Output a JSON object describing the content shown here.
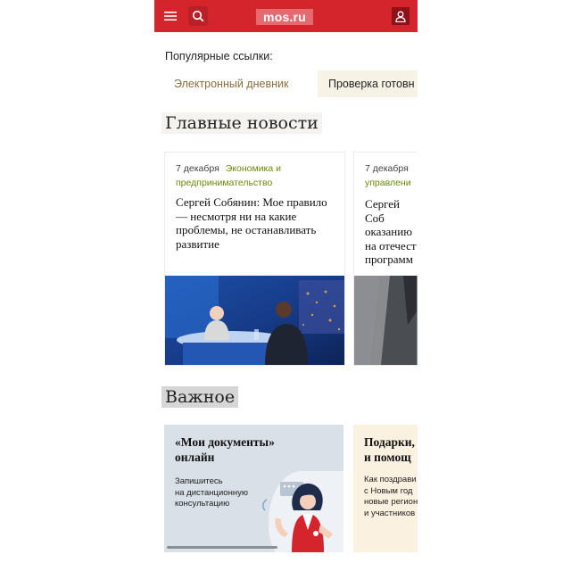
{
  "header": {
    "logo": "mos.ru",
    "icons": [
      "menu-icon",
      "search-icon",
      "user-icon"
    ],
    "colors": {
      "bar": "#d4252d",
      "logo_bg": "#e36a6f",
      "user_bg": "#8c1219"
    }
  },
  "popular": {
    "title": "Популярные ссылки:",
    "links": [
      "Электронный дневник",
      "Проверка готовн"
    ]
  },
  "news": {
    "title": "Главные новости",
    "cards": [
      {
        "date": "7 декабря",
        "category": "Экономика и предпринимательство",
        "headline": "Сергей Собянин: Мое правило — несмотря ни на какие проблемы, не останавливать развитие"
      },
      {
        "date": "7 декабря",
        "category": "управлени",
        "headline": "Сергей Соб оказанию на отечест программ"
      }
    ]
  },
  "important": {
    "title": "Важное",
    "cards": [
      {
        "title": "«Мои документы»\nонлайн",
        "text": "Запишитесь\nна дистанционную\nконсультацию"
      },
      {
        "title": "Подарки,\nи помощ",
        "text": "Как поздрави\nс Новым год\nновые регион\nи участников"
      }
    ]
  }
}
